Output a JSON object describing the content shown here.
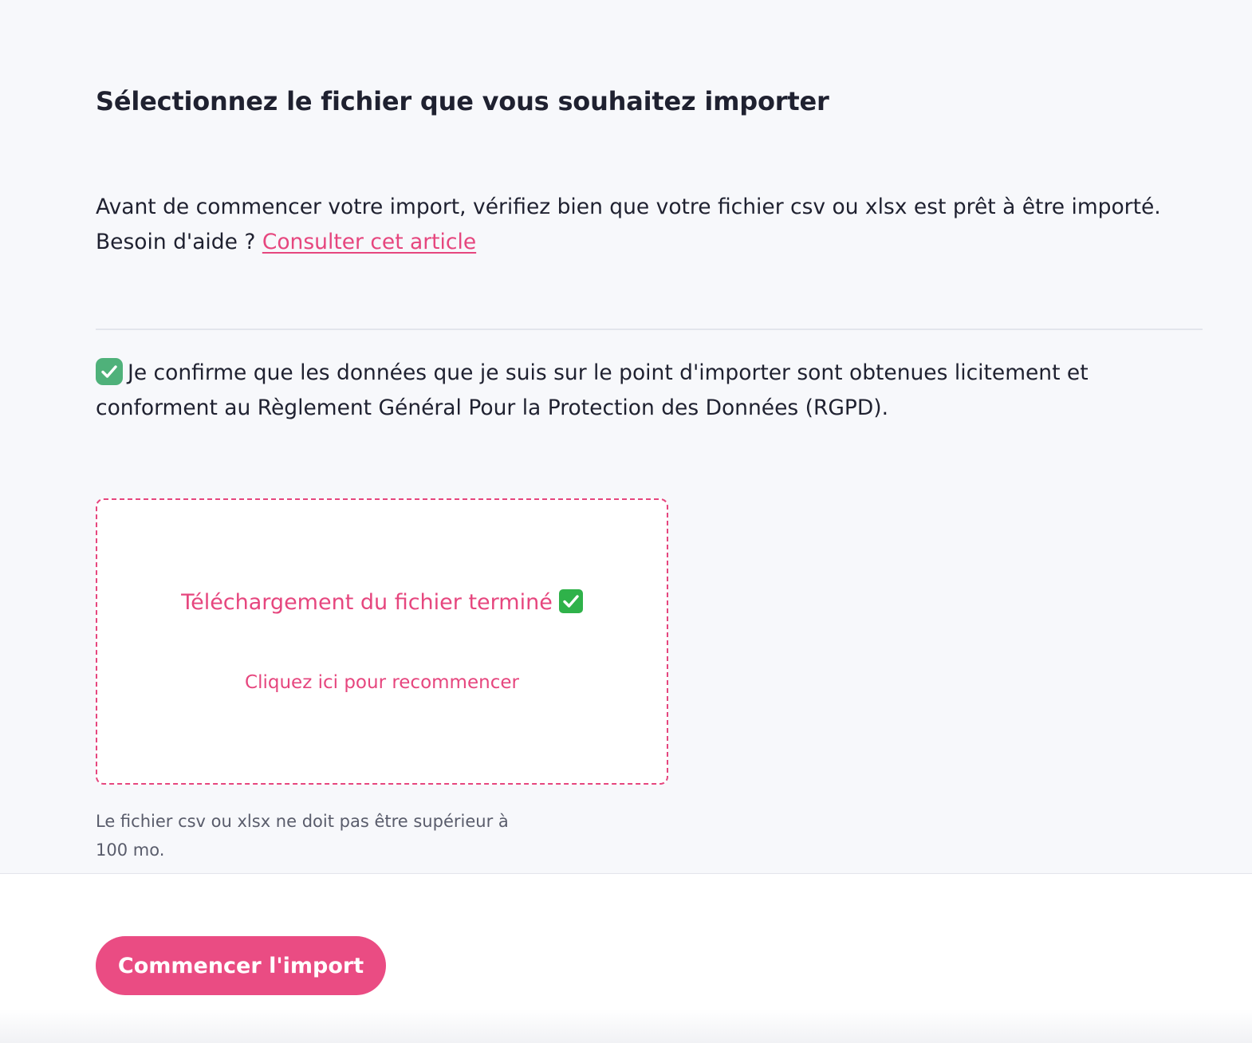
{
  "page": {
    "title": "Sélectionnez le fichier que vous souhaitez importer",
    "intro_line1": "Avant de commencer votre import, vérifiez bien que votre fichier csv ou xlsx est prêt à être importé.",
    "intro_line2_prefix": "Besoin d'aide ? ",
    "help_link": "Consulter cet article"
  },
  "consent": {
    "checked": true,
    "line1": "Je confirme que les données que je suis sur le point d'importer sont obtenues licitement et",
    "line2": "conforment au Règlement Général Pour la Protection des Données (RGPD)."
  },
  "upload": {
    "status": "Téléchargement du fichier terminé",
    "status_icon": "white-check-mark-emoji",
    "restart_label": "Cliquez ici pour recommencer",
    "hint_line1": "Le fichier csv ou xlsx ne doit pas être supérieur à",
    "hint_line2": "100 mo.",
    "accent_color": "#e6467e"
  },
  "footer": {
    "start_button": "Commencer l'import",
    "button_color": "#ea4c83"
  }
}
